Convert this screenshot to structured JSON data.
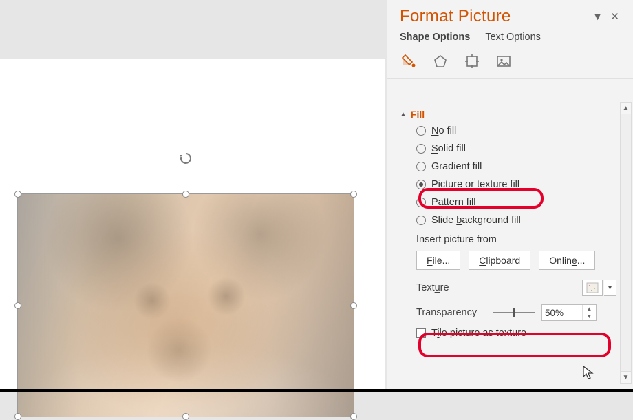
{
  "pane": {
    "title": "Format Picture",
    "tabs": {
      "shape": "Shape Options",
      "text": "Text Options"
    },
    "section": "Fill",
    "options": {
      "no_fill": {
        "pre": "",
        "u": "N",
        "post": "o fill"
      },
      "solid": {
        "pre": "",
        "u": "S",
        "post": "olid fill"
      },
      "gradient": {
        "pre": "",
        "u": "G",
        "post": "radient fill"
      },
      "picture": {
        "pre": "",
        "u": "P",
        "post": "icture or texture fill"
      },
      "pattern": {
        "pre": "P",
        "u": "a",
        "post": "ttern fill"
      },
      "slide_bg": {
        "pre": "Slide ",
        "u": "b",
        "post": "ackground fill"
      }
    },
    "insert_from_label": "Insert picture from",
    "buttons": {
      "file": {
        "pre": "",
        "u": "F",
        "post": "ile..."
      },
      "clipboard": {
        "pre": "",
        "u": "C",
        "post": "lipboard"
      },
      "online": {
        "pre": "Onlin",
        "u": "e",
        "post": "..."
      }
    },
    "texture_label_pre": "Text",
    "texture_label_u": "u",
    "texture_label_post": "re",
    "transparency_label_u": "T",
    "transparency_label_post": "ransparency",
    "transparency_value": "50%",
    "tile_label_pre": "T",
    "tile_label_u": "i",
    "tile_label_post": "le picture as texture"
  }
}
